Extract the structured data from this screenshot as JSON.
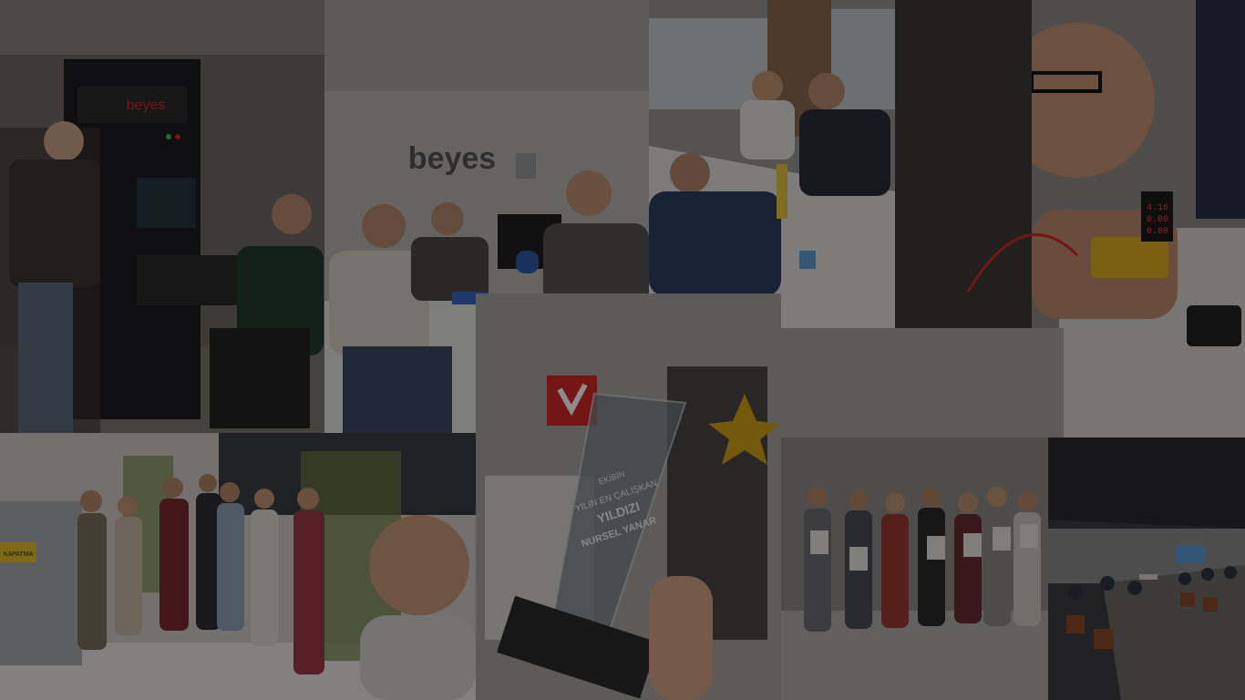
{
  "photos": [
    {
      "label": "server-rack-lab"
    },
    {
      "label": "office-team-desk",
      "logo_text": "beyes"
    },
    {
      "label": "workshop-activity"
    },
    {
      "label": "electronics-measurement",
      "meter": {
        "v1": "4.16",
        "v2": "0.00",
        "v3": "0.00"
      }
    },
    {
      "label": "group-photo",
      "sign_text": "KAPATMA"
    },
    {
      "label": "award-trophy",
      "trophy_lines": [
        "EKİBİN",
        "YILIN EN ÇALIŞKAN",
        "YILDIZI",
        "NURSEL YANAR"
      ]
    },
    {
      "label": "certificate-ceremony"
    },
    {
      "label": "training-hall"
    }
  ],
  "colors": {
    "brand_red": "#d62828",
    "gold": "#d4a017",
    "dark": "#1e1e1e"
  }
}
